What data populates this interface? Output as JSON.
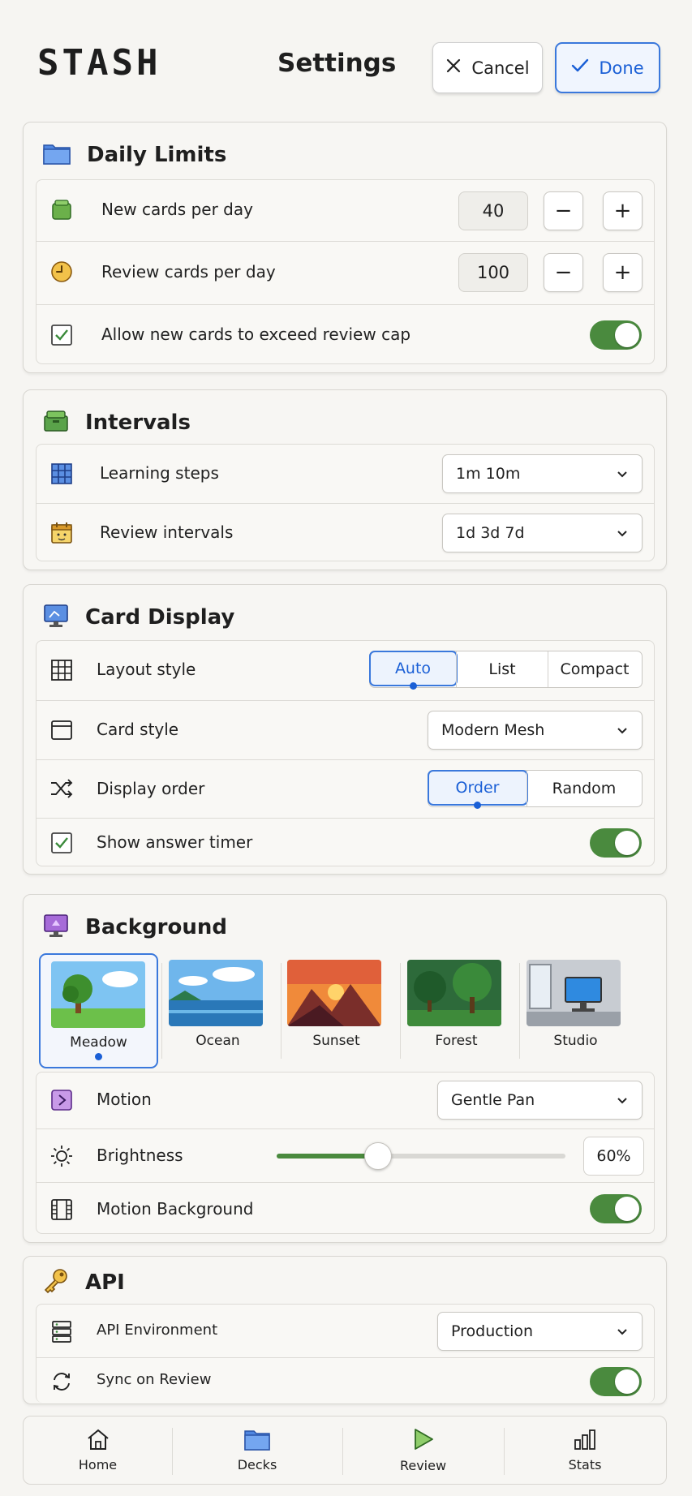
{
  "header": {
    "logo": "STASH",
    "title": "Settings",
    "cancel_label": "Cancel",
    "done_label": "Done"
  },
  "daily_limits": {
    "title": "Daily Limits",
    "new_cards_label": "New cards per day",
    "new_cards_value": "40",
    "review_cards_label": "Review cards per day",
    "review_cards_value": "100",
    "exceed_label": "Allow new cards to exceed review cap",
    "exceed_on": true,
    "minus": "−",
    "plus": "+"
  },
  "intervals": {
    "title": "Intervals",
    "learning_label": "Learning steps",
    "learning_value": "1m 10m",
    "review_label": "Review intervals",
    "review_value": "1d 3d 7d"
  },
  "card_display": {
    "title": "Card Display",
    "layout_label": "Layout style",
    "layout_options": [
      "Auto",
      "List",
      "Compact"
    ],
    "layout_selected": "Auto",
    "style_label": "Card style",
    "style_value": "Modern Mesh",
    "order_label": "Display order",
    "order_options": [
      "Order",
      "Random"
    ],
    "order_selected": "Order",
    "timer_label": "Show answer timer",
    "timer_on": true
  },
  "background": {
    "title": "Background",
    "thumbs": [
      "Meadow",
      "Ocean",
      "Sunset",
      "Forest",
      "Studio"
    ],
    "selected": "Meadow",
    "motion_label": "Motion",
    "motion_value": "Gentle Pan",
    "brightness_label": "Brightness",
    "brightness_value": "60%",
    "brightness_level": 0.35,
    "motion_bg_label": "Motion Background",
    "motion_bg_on": true
  },
  "api": {
    "title": "API",
    "env_label": "API Environment",
    "env_value": "Production",
    "sync_label": "Sync on Review",
    "sync_on": true
  },
  "nav": {
    "home": "Home",
    "decks": "Decks",
    "review": "Review",
    "stats": "Stats"
  },
  "colors": {
    "accent": "#1a5fd6",
    "toggle_on": "#4a8a3e"
  }
}
